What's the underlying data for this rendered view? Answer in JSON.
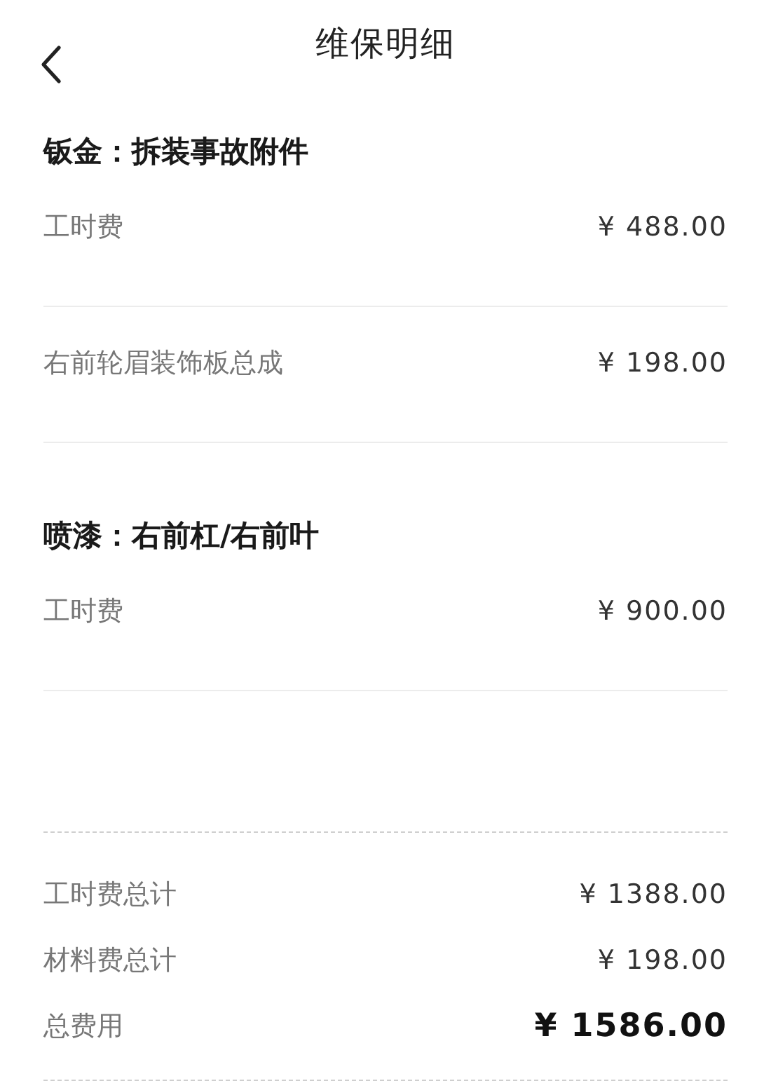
{
  "header": {
    "title": "维保明细"
  },
  "sections": [
    {
      "title": "钣金：拆装事故附件",
      "items": [
        {
          "name": "工时费",
          "amount": "¥ 488.00"
        },
        {
          "name": "右前轮眉装饰板总成",
          "amount": "¥ 198.00"
        }
      ]
    },
    {
      "title": "喷漆：右前杠/右前叶",
      "items": [
        {
          "name": "工时费",
          "amount": "¥ 900.00"
        }
      ]
    }
  ],
  "totals": [
    {
      "kind": "subtotal",
      "label": "工时费总计",
      "amount": "¥ 1388.00"
    },
    {
      "kind": "subtotal",
      "label": "材料费总计",
      "amount": "¥ 198.00"
    },
    {
      "kind": "grand",
      "label": "总费用",
      "amount": "¥ 1586.00"
    }
  ]
}
